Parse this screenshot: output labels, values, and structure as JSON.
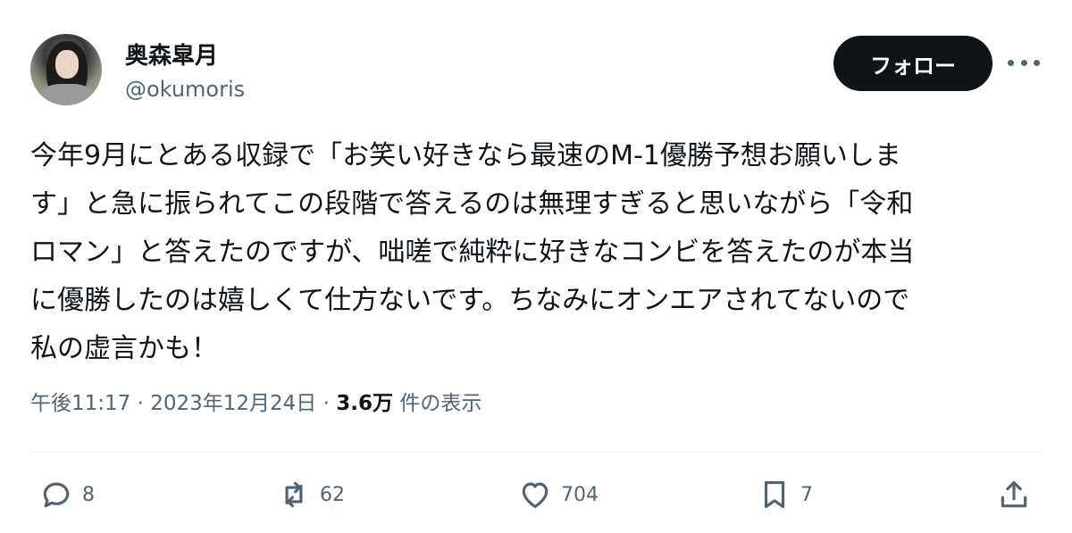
{
  "author": {
    "display_name": "奥森皐月",
    "handle": "@okumoris"
  },
  "follow_label": "フォロー",
  "tweet": {
    "lines": [
      "今年9月にとある収録で「お笑い好きなら最速のM-1優勝予想お願いしま",
      "す」と急に振られてこの段階で答えるのは無理すぎると思いながら「令和",
      "ロマン」と答えたのですが、咄嗟で純粋に好きなコンビを答えたのが本当",
      "に優勝したのは嬉しくて仕方ないです。ちなみにオンエアされてないので",
      "私の虚言かも！"
    ]
  },
  "meta": {
    "time": "午後11:17",
    "separator": "·",
    "date": "2023年12月24日",
    "views_count": "3.6万",
    "views_label": "件の表示"
  },
  "actions": {
    "replies": "8",
    "reposts": "62",
    "likes": "704",
    "bookmarks": "7"
  },
  "icons": {
    "reply": "reply-icon",
    "repost": "repost-icon",
    "like": "heart-icon",
    "bookmark": "bookmark-icon",
    "share": "share-icon",
    "more": "more-icon"
  },
  "colors": {
    "primary_text": "#0f1419",
    "secondary_text": "#536471",
    "follow_bg": "#0f1419"
  }
}
